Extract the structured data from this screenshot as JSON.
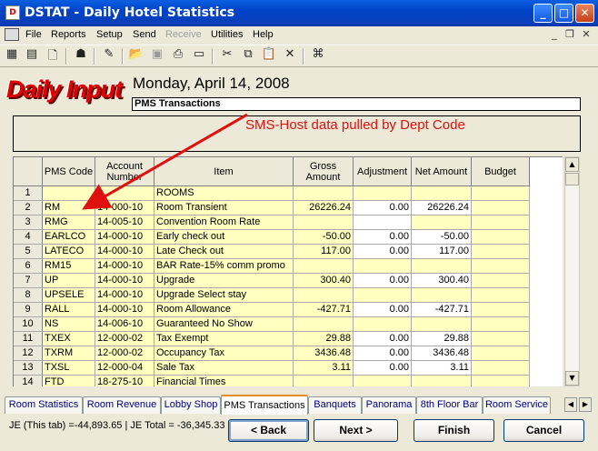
{
  "window": {
    "title": "DSTAT - Daily Hotel Statistics"
  },
  "menu": [
    "File",
    "Reports",
    "Setup",
    "Send",
    "Receive",
    "Utilities",
    "Help"
  ],
  "header": {
    "logo_text": "Daily Input",
    "date_title": "Monday, April 14, 2008",
    "section": "PMS Transactions"
  },
  "annotation": {
    "text": "SMS-Host data pulled by Dept Code",
    "color": "#e01010"
  },
  "grid": {
    "columns": [
      "PMS Code",
      "Account Number",
      "Item",
      "Gross Amount",
      "Adjustment",
      "Net Amount",
      "Budget"
    ],
    "rows": [
      {
        "num": "1",
        "code": "",
        "account": "",
        "item": "ROOMS",
        "gross": "",
        "adj": "",
        "net": ""
      },
      {
        "num": "2",
        "code": "RM",
        "account": "14-000-10",
        "item": "Room Transient",
        "gross": "26226.24",
        "adj": "0.00",
        "net": "26226.24"
      },
      {
        "num": "3",
        "code": "RMG",
        "account": "14-005-10",
        "item": "Convention Room Rate",
        "gross": "",
        "adj": "",
        "net": ""
      },
      {
        "num": "4",
        "code": "EARLCO",
        "account": "14-000-10",
        "item": "Early check out",
        "gross": "-50.00",
        "adj": "0.00",
        "net": "-50.00"
      },
      {
        "num": "5",
        "code": "LATECO",
        "account": "14-000-10",
        "item": "Late Check out",
        "gross": "117.00",
        "adj": "0.00",
        "net": "117.00"
      },
      {
        "num": "6",
        "code": "RM15",
        "account": "14-000-10",
        "item": "BAR Rate-15% comm promo",
        "gross": "",
        "adj": "",
        "net": ""
      },
      {
        "num": "7",
        "code": "UP",
        "account": "14-000-10",
        "item": "Upgrade",
        "gross": "300.40",
        "adj": "0.00",
        "net": "300.40"
      },
      {
        "num": "8",
        "code": "UPSELE",
        "account": "14-000-10",
        "item": "Upgrade Select stay",
        "gross": "",
        "adj": "",
        "net": ""
      },
      {
        "num": "9",
        "code": "RALL",
        "account": "14-000-10",
        "item": "Room Allowance",
        "gross": "-427.71",
        "adj": "0.00",
        "net": "-427.71"
      },
      {
        "num": "10",
        "code": "NS",
        "account": "14-006-10",
        "item": "Guaranteed No Show",
        "gross": "",
        "adj": "",
        "net": ""
      },
      {
        "num": "11",
        "code": "TXEX",
        "account": "12-000-02",
        "item": "Tax Exempt",
        "gross": "29.88",
        "adj": "0.00",
        "net": "29.88"
      },
      {
        "num": "12",
        "code": "TXRM",
        "account": "12-000-02",
        "item": "Occupancy Tax",
        "gross": "3436.48",
        "adj": "0.00",
        "net": "3436.48"
      },
      {
        "num": "13",
        "code": "TXSL",
        "account": "12-000-04",
        "item": "Sale Tax",
        "gross": "3.11",
        "adj": "0.00",
        "net": "3.11"
      },
      {
        "num": "14",
        "code": "FTD",
        "account": "18-275-10",
        "item": "Financial Times",
        "gross": "",
        "adj": "",
        "net": ""
      }
    ]
  },
  "tabs": [
    "Room Statistics",
    "Room Revenue",
    "Lobby Shop",
    "PMS Transactions",
    "Banquets",
    "Panorama",
    "8th Floor Bar",
    "Room Service"
  ],
  "active_tab": "PMS Transactions",
  "status": {
    "text": "JE (This tab) =-44,893.65 | JE Total = -36,345.33"
  },
  "buttons": {
    "back": "< Back",
    "next": "Next >",
    "finish": "Finish",
    "cancel": "Cancel"
  },
  "colors": {
    "grid_cell": "#ffffc0",
    "logo": "#e00000",
    "titlebar": "#0a3fb8"
  }
}
